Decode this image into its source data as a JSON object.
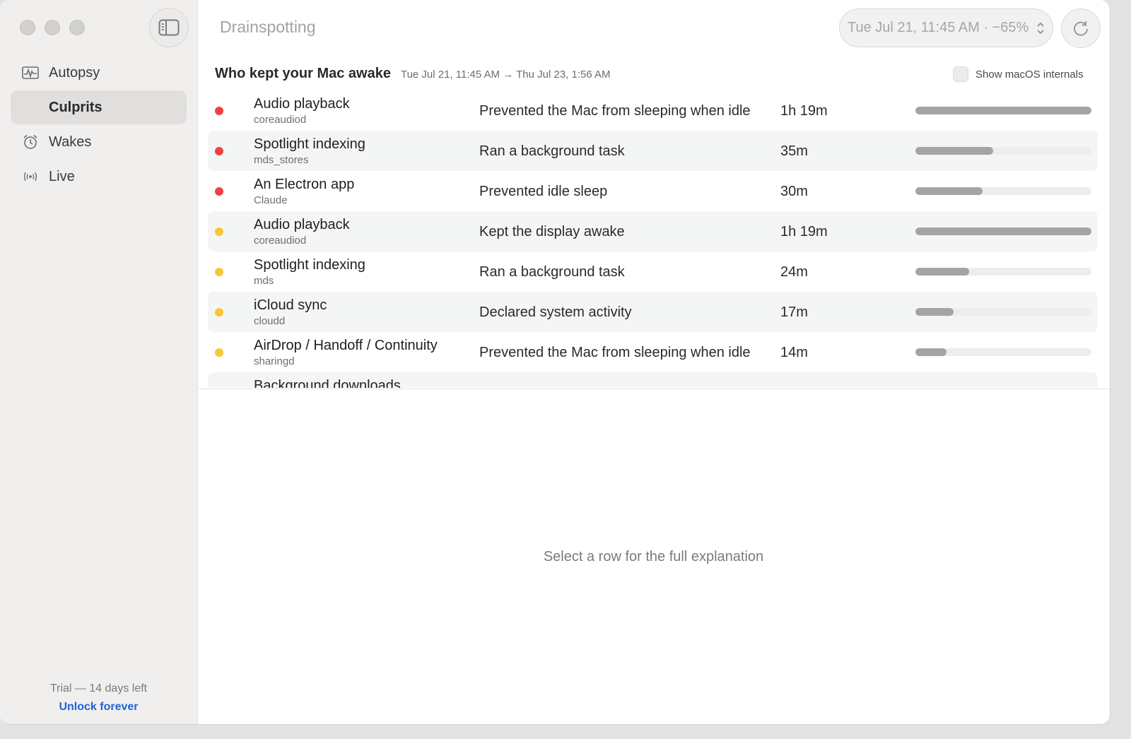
{
  "app": {
    "title": "Drainspotting"
  },
  "sidebar": {
    "items": [
      {
        "label": "Autopsy",
        "icon": "waveform-chart-icon"
      },
      {
        "label": "Culprits",
        "icon": "",
        "selected": true
      },
      {
        "label": "Wakes",
        "icon": "alarm-clock-icon"
      },
      {
        "label": "Live",
        "icon": "broadcast-icon"
      }
    ],
    "trial_text": "Trial — 14 days left",
    "unlock_label": "Unlock forever"
  },
  "toolbar": {
    "range_value": "Tue Jul 21, 11:45 AM · −65%"
  },
  "section": {
    "title": "Who kept your Mac awake",
    "range": "Tue Jul 21, 11:45 AM → Thu Jul 23, 1:56 AM",
    "internals_label": "Show macOS internals",
    "internals_checked": false
  },
  "colors": {
    "high": "#ee4141",
    "medium": "#f8c537",
    "bar": "#a4a4a4",
    "link": "#1e63d6"
  },
  "rows": [
    {
      "name": "Audio playback",
      "process": "coreaudiod",
      "reason": "Prevented the Mac from sleeping when idle",
      "duration": "1h 19m",
      "severity": "high",
      "share": 1.0
    },
    {
      "name": "Spotlight indexing",
      "process": "mds_stores",
      "reason": "Ran a background task",
      "duration": "35m",
      "severity": "high",
      "share": 0.443
    },
    {
      "name": "An Electron app",
      "process": "Claude",
      "reason": "Prevented idle sleep",
      "duration": "30m",
      "severity": "high",
      "share": 0.38
    },
    {
      "name": "Audio playback",
      "process": "coreaudiod",
      "reason": "Kept the display awake",
      "duration": "1h 19m",
      "severity": "medium",
      "share": 1.0
    },
    {
      "name": "Spotlight indexing",
      "process": "mds",
      "reason": "Ran a background task",
      "duration": "24m",
      "severity": "medium",
      "share": 0.304
    },
    {
      "name": "iCloud sync",
      "process": "cloudd",
      "reason": "Declared system activity",
      "duration": "17m",
      "severity": "medium",
      "share": 0.215
    },
    {
      "name": "AirDrop / Handoff / Continuity",
      "process": "sharingd",
      "reason": "Prevented the Mac from sleeping when idle",
      "duration": "14m",
      "severity": "medium",
      "share": 0.177
    },
    {
      "name": "Background downloads",
      "process": "",
      "reason": "",
      "duration": "",
      "severity": "",
      "share": 0
    }
  ],
  "detail": {
    "placeholder": "Select a row for the full explanation"
  }
}
